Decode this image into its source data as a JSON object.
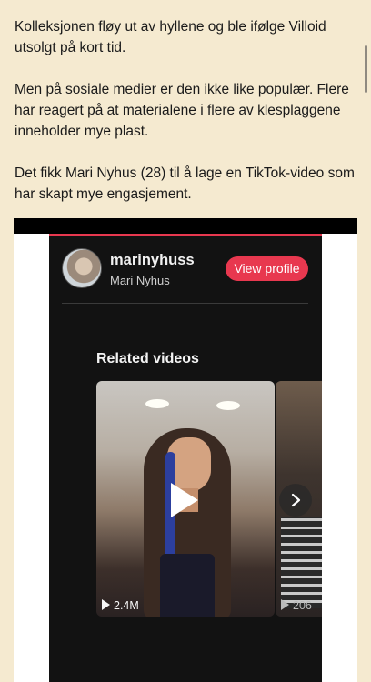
{
  "article": {
    "paragraphs": [
      "Kolleksjonen fløy ut av hyllene og ble ifølge Villoid utsolgt på kort tid.",
      "Men på sosiale medier er den ikke like populær. Flere har reagert på at materialene i flere av klesplaggene inneholder mye plast.",
      "Det fikk Mari Nyhus (28) til å lage en TikTok-video som har skapt mye engasjement."
    ]
  },
  "tiktok": {
    "username": "marinyhuss",
    "fullname": "Mari Nyhus",
    "view_profile_label": "View profile",
    "related_title": "Related videos",
    "videos": [
      {
        "views": "2.4M"
      },
      {
        "views": "206"
      }
    ],
    "accent_color": "#e8384f"
  }
}
